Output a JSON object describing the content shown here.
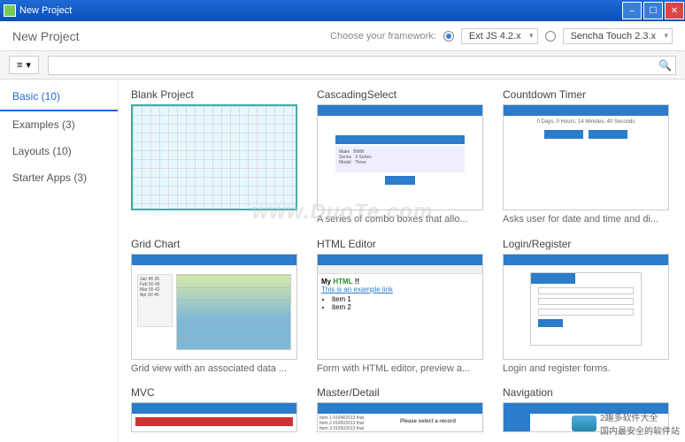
{
  "window": {
    "title": "New Project"
  },
  "header": {
    "title": "New Project",
    "choose_label": "Choose your framework:",
    "fw1": "Ext JS 4.2.x",
    "fw2": "Sencha Touch 2.3.x"
  },
  "toolbar": {
    "view_icon": "≡",
    "view_arrow": "▾"
  },
  "search": {
    "placeholder": ""
  },
  "sidebar": {
    "items": [
      {
        "label": "Basic (10)"
      },
      {
        "label": "Examples (3)"
      },
      {
        "label": "Layouts (10)"
      },
      {
        "label": "Starter Apps (3)"
      }
    ]
  },
  "cards": [
    {
      "title": "Blank Project",
      "desc": ""
    },
    {
      "title": "CascadingSelect",
      "desc": "A series of combo boxes that allo..."
    },
    {
      "title": "Countdown Timer",
      "desc": "Asks user for date and time and di...",
      "countdown": "0 Days, 0 Hours, 14 Minutes, 40 Seconds"
    },
    {
      "title": "Grid Chart",
      "desc": "Grid view with an associated data ..."
    },
    {
      "title": "HTML Editor",
      "desc": "Form with HTML editor, preview a...",
      "heading": "My",
      "heading2": "HTML",
      "heading3": "!!",
      "link": "This is an example link",
      "li1": "item 1",
      "li2": "item 2"
    },
    {
      "title": "Login/Register",
      "desc": "Login and register forms."
    },
    {
      "title": "MVC",
      "desc": ""
    },
    {
      "title": "Master/Detail",
      "desc": "",
      "prompt": "Please select a record"
    },
    {
      "title": "Navigation",
      "desc": ""
    }
  ],
  "watermark": "www.DuoTe.com",
  "badge": {
    "line1": "2趣多软件大全",
    "line2": "国内最安全的软件站"
  }
}
